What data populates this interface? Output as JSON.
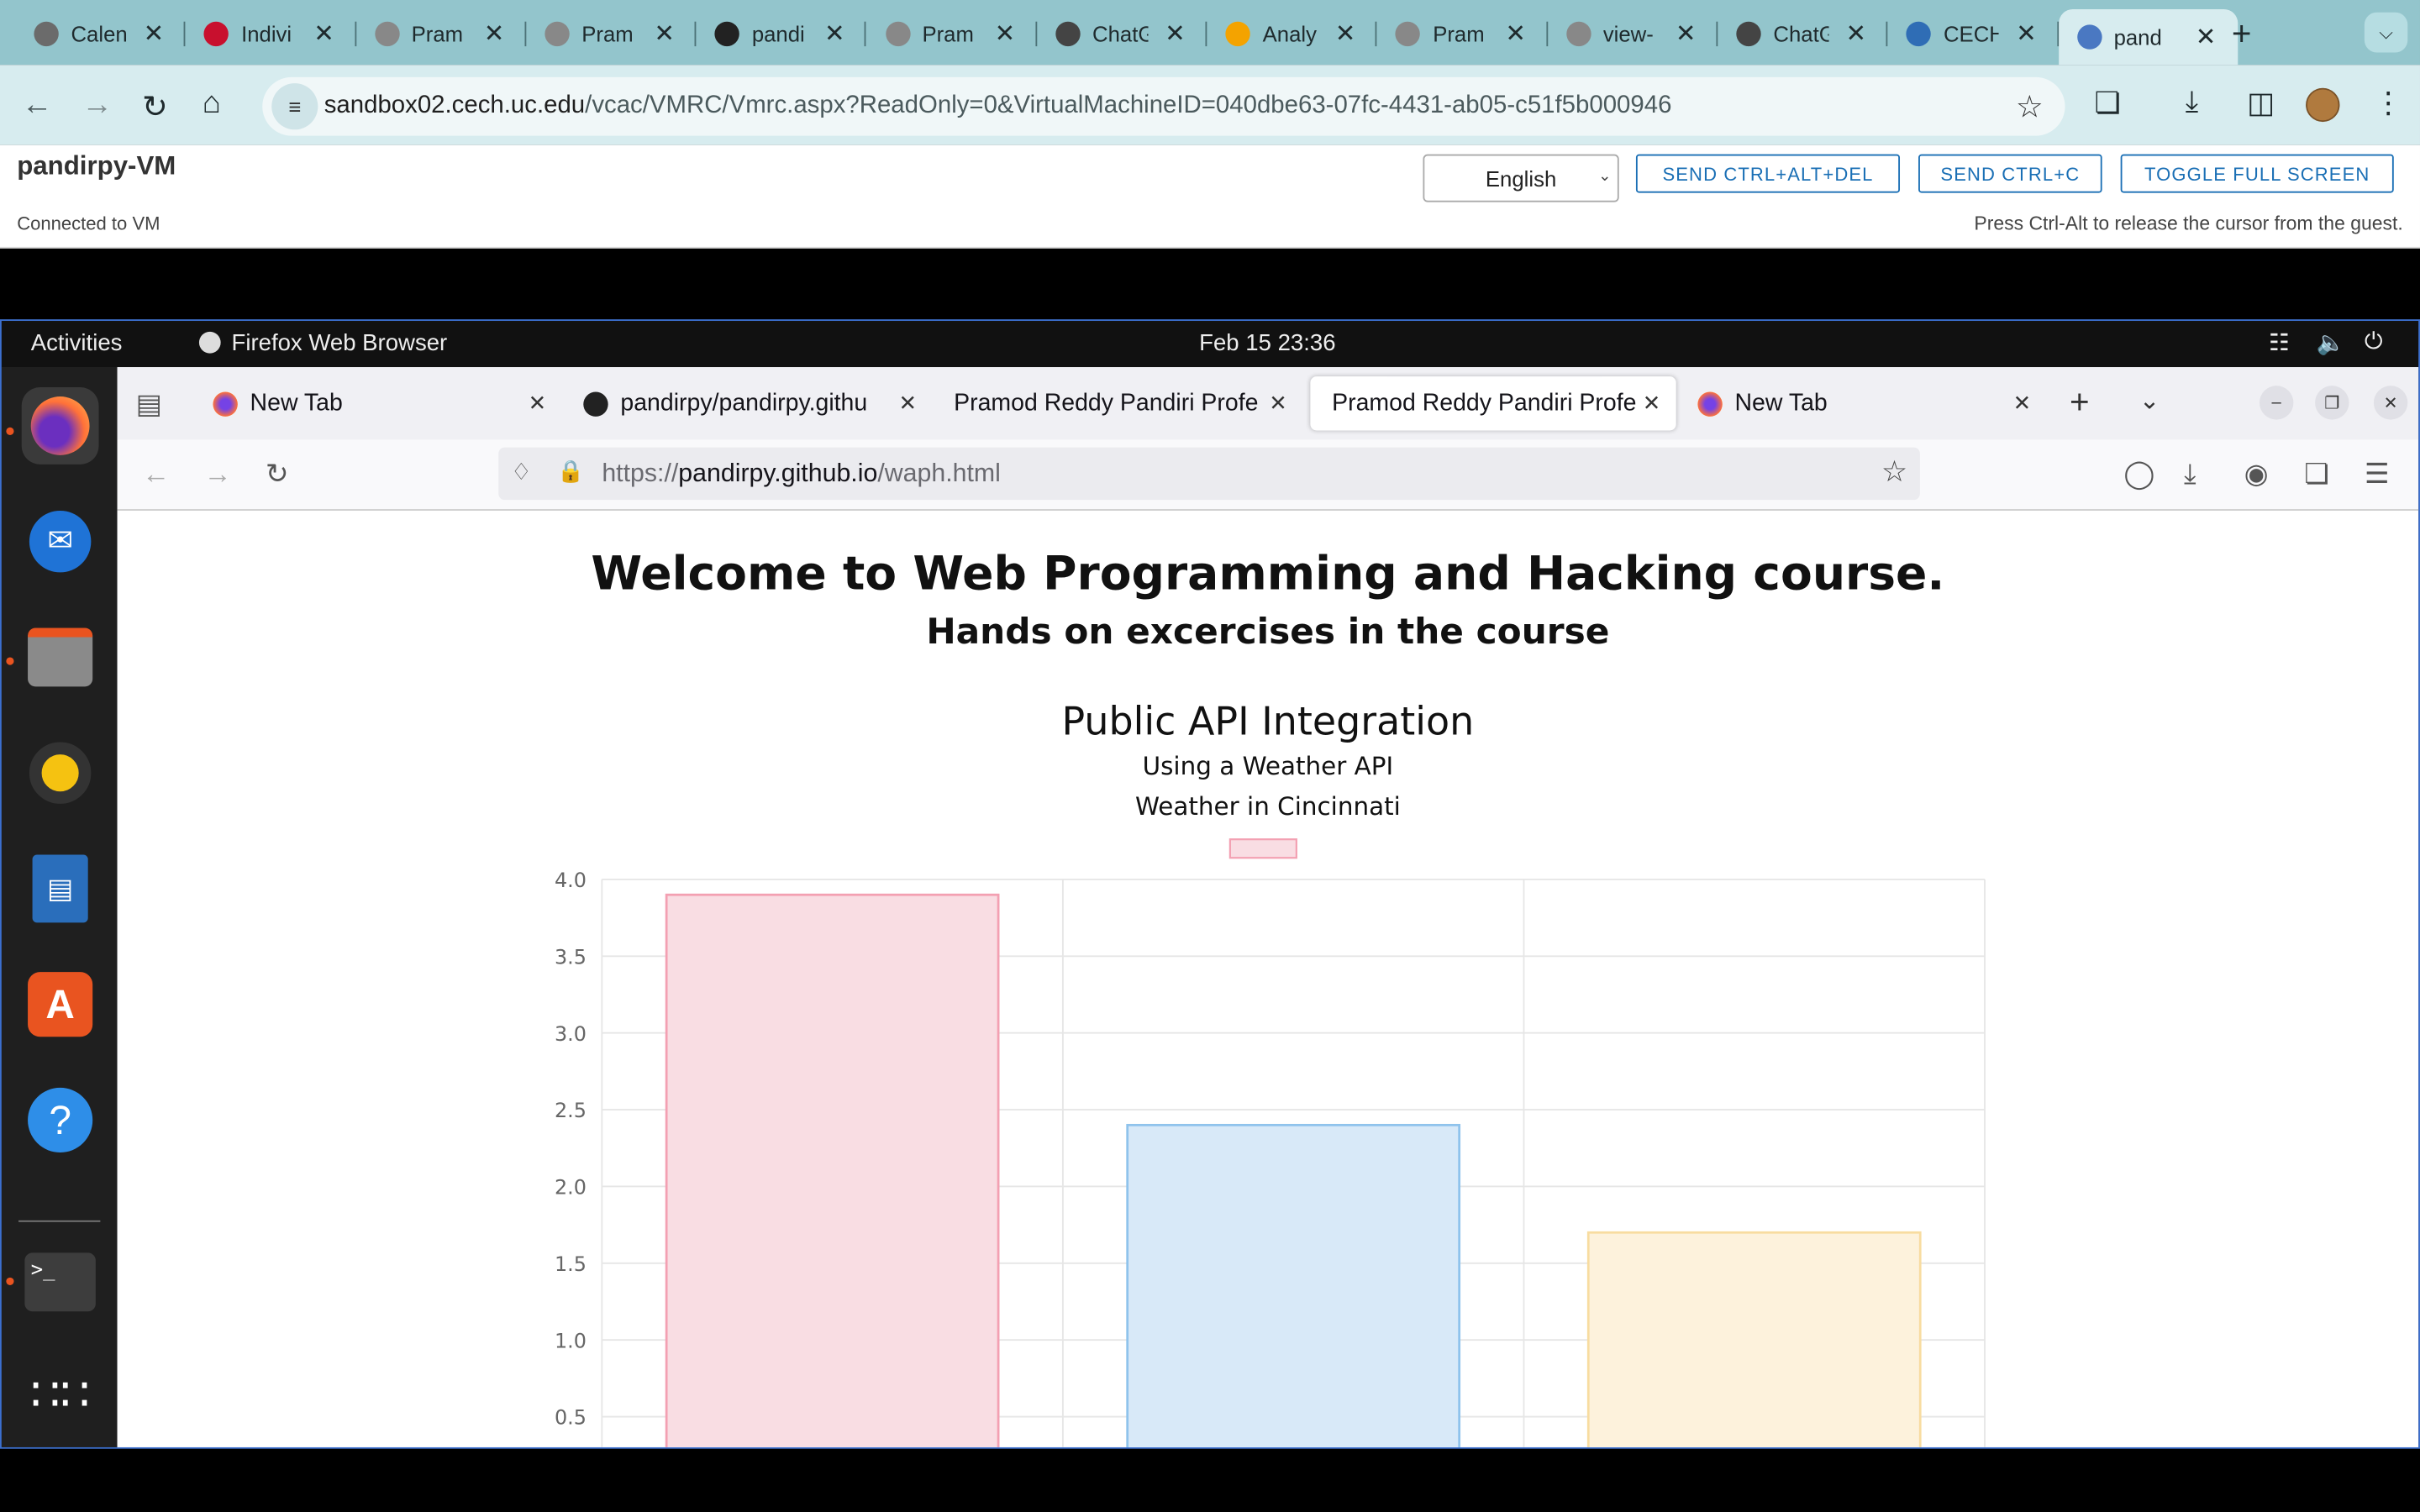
{
  "chrome": {
    "tabs": [
      {
        "title": "Calen",
        "color": "#6b6b6b"
      },
      {
        "title": "Indivi",
        "color": "#c8102e"
      },
      {
        "title": "Pram",
        "color": "#888"
      },
      {
        "title": "Pram",
        "color": "#888"
      },
      {
        "title": "pandi",
        "color": "#222"
      },
      {
        "title": "Pram",
        "color": "#888"
      },
      {
        "title": "ChatG",
        "color": "#444"
      },
      {
        "title": "Analy",
        "color": "#f4a300"
      },
      {
        "title": "Pram",
        "color": "#888"
      },
      {
        "title": "view-",
        "color": "#888"
      },
      {
        "title": "ChatG",
        "color": "#444"
      },
      {
        "title": "CECH",
        "color": "#2f6db5"
      },
      {
        "title": "pand",
        "color": "#4a78c2"
      }
    ],
    "address": {
      "domain": "sandbox02.cech.uc.edu",
      "path": "/vcac/VMRC/Vmrc.aspx?ReadOnly=0&VirtualMachineID=040dbe63-07fc-4431-ab05-c51f5b000946"
    }
  },
  "vmrc": {
    "vm_name": "pandirpy-VM",
    "status": "Connected to VM",
    "language": "English",
    "btn_ctrl_alt_del": "SEND CTRL+ALT+DEL",
    "btn_ctrl_c": "SEND CTRL+C",
    "btn_fullscreen": "TOGGLE FULL SCREEN",
    "hint": "Press Ctrl-Alt to release the cursor from the guest."
  },
  "guest": {
    "activities": "Activities",
    "app_name": "Firefox Web Browser",
    "clock": "Feb 15  23:36",
    "firefox": {
      "tabs": [
        {
          "title": "New Tab"
        },
        {
          "title": "pandirpy/pandirpy.githu"
        },
        {
          "title": "Pramod Reddy Pandiri Profe"
        },
        {
          "title": "Pramod Reddy Pandiri Profe"
        },
        {
          "title": "New Tab"
        }
      ],
      "url_prefix": "https://",
      "url_host": "pandirpy.github.io",
      "url_path": "/waph.html"
    },
    "page": {
      "heading1": "Welcome to Web Programming and Hacking course.",
      "heading2": "Hands on excercises in the course",
      "section_title": "Public API Integration",
      "subtitle1": "Using a Weather API",
      "subtitle2": "Weather in Cincinnati"
    }
  },
  "chart_data": {
    "type": "bar",
    "categories": [
      "",
      "",
      ""
    ],
    "values": [
      3.9,
      2.4,
      1.7
    ],
    "colors": [
      "#f9dde3",
      "#d8e9f8",
      "#fdf2dc"
    ],
    "borders": [
      "#f3a0b2",
      "#8fc3ec",
      "#f8dca0"
    ],
    "legend_swatch": {
      "fill": "#f9dde3",
      "border": "#f3a0b2"
    },
    "ylim": [
      0,
      4.0
    ],
    "yticks": [
      "4.0",
      "3.5",
      "3.0",
      "2.5",
      "2.0",
      "1.5",
      "1.0",
      "0.5"
    ],
    "grid": true
  }
}
